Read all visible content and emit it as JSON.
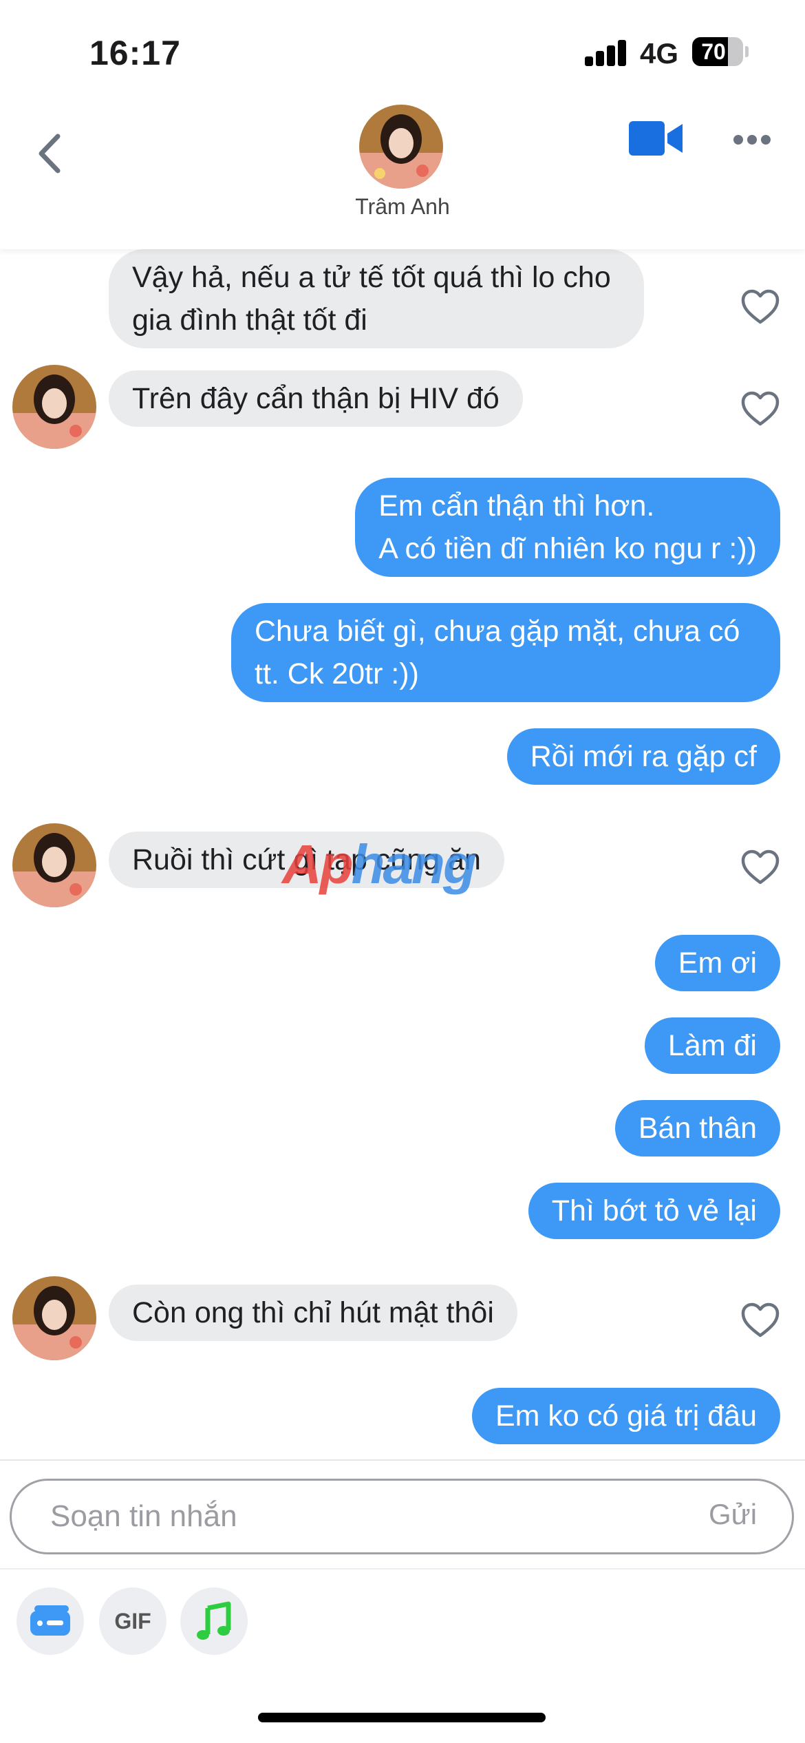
{
  "status_bar": {
    "time": "16:17",
    "network": "4G",
    "battery": "70",
    "battery_level_percent": 70
  },
  "header": {
    "contact_name": "Trâm Anh",
    "icons": [
      "back-chevron-icon",
      "video-camera-icon",
      "more-dots-icon"
    ],
    "accent_color": "#1a6fe0"
  },
  "messages": [
    {
      "sender": "contact",
      "text": "Vậy hả, nếu a tử tế tốt quá thì lo cho gia đình thật tốt đi"
    },
    {
      "sender": "contact",
      "text": "Trên đây cẩn thận bị HIV đó"
    },
    {
      "sender": "me",
      "text": "Em cẩn thận thì hơn.\nA có tiền dĩ nhiên ko ngu r :))"
    },
    {
      "sender": "me",
      "text": "Chưa biết gì, chưa gặp mặt, chưa có tt. Ck 20tr :))"
    },
    {
      "sender": "me",
      "text": "Rồi mới ra gặp cf"
    },
    {
      "sender": "contact",
      "text": "Ruồi thì cứt gì tạp cũng ăn"
    },
    {
      "sender": "me",
      "text": "Em ơi"
    },
    {
      "sender": "me",
      "text": "Làm đi"
    },
    {
      "sender": "me",
      "text": "Bán thân"
    },
    {
      "sender": "me",
      "text": "Thì bớt tỏ vẻ lại"
    },
    {
      "sender": "contact",
      "text": "Còn ong thì chỉ hút mật thôi"
    },
    {
      "sender": "me",
      "text": "Em ko có giá trị đâu"
    }
  ],
  "watermark": {
    "part1": "Ap",
    "part2": "hang"
  },
  "composer": {
    "placeholder": "Soạn tin nhắn",
    "send_label": "Gửi"
  },
  "toolbar": {
    "gif_label": "GIF",
    "icons": [
      "sticker-card-icon",
      "gif-icon",
      "music-note-icon"
    ]
  },
  "colors": {
    "outgoing_bubble": "#3d99f5",
    "incoming_bubble": "#eaebed",
    "music_icon": "#2ecc40"
  }
}
